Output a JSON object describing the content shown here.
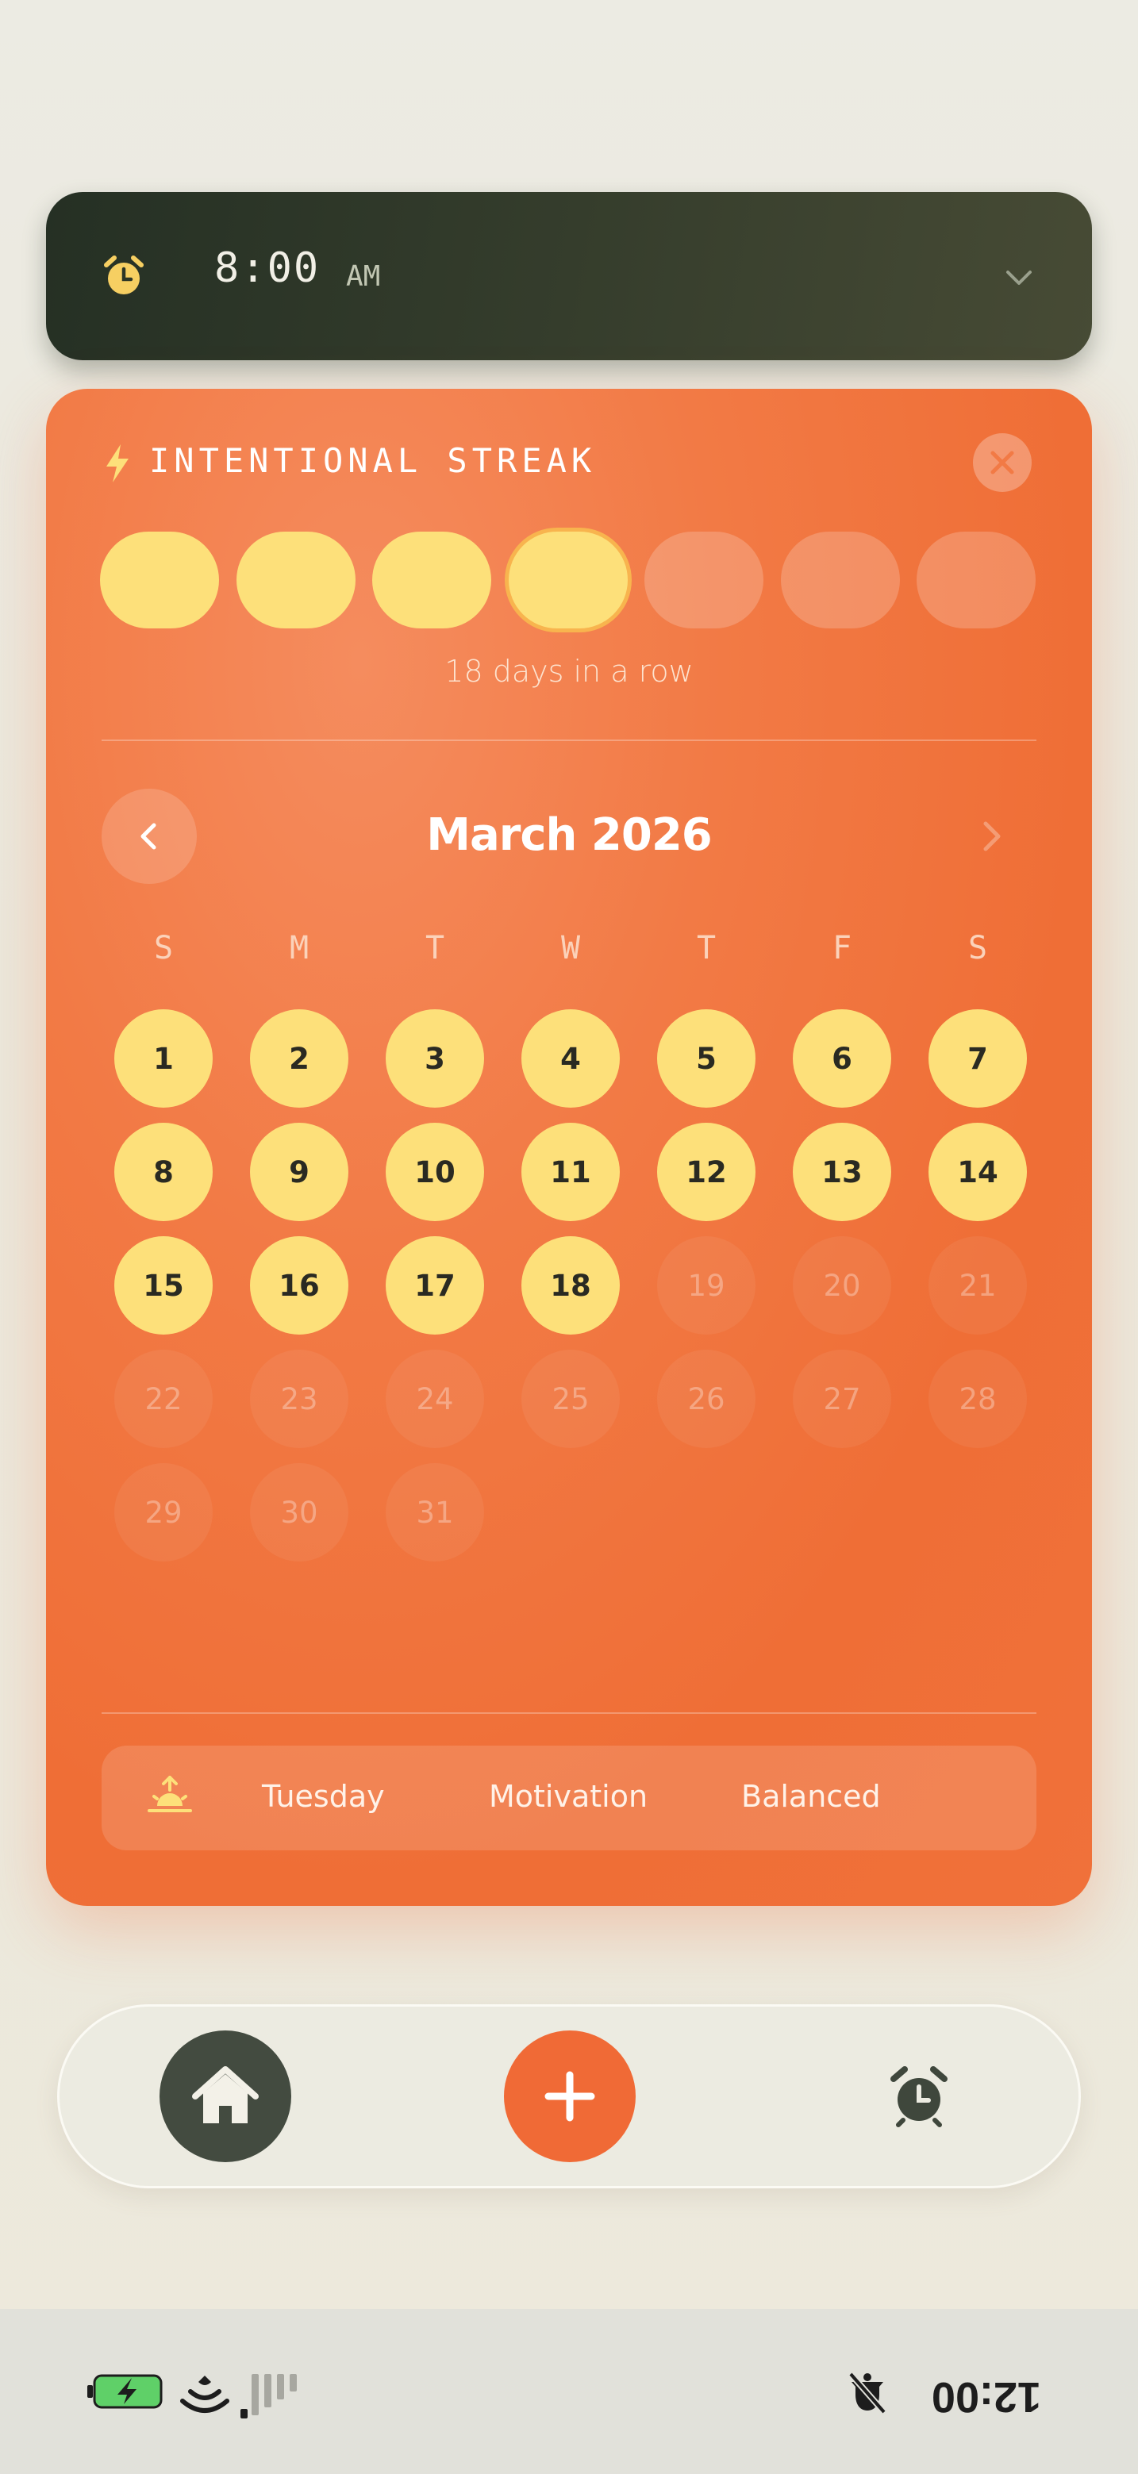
{
  "alarm": {
    "time": "8:00",
    "ampm": "AM",
    "icon": "alarm-clock-icon",
    "expand_icon": "chevron-down-icon"
  },
  "streak_card": {
    "title": "INTENTIONAL STREAK",
    "title_icon": "lightning-bolt-icon",
    "close_icon": "close-x-icon",
    "pills": [
      {
        "state": "filled"
      },
      {
        "state": "filled"
      },
      {
        "state": "filled"
      },
      {
        "state": "current"
      },
      {
        "state": "empty"
      },
      {
        "state": "empty"
      },
      {
        "state": "empty"
      }
    ],
    "streak_text": "18 days in a row",
    "calendar": {
      "month_label": "March 2026",
      "weekdays": [
        "S",
        "M",
        "T",
        "W",
        "T",
        "F",
        "S"
      ],
      "first_weekday_index": 0,
      "days_in_month": 31,
      "completed_through": 18
    },
    "info": {
      "icon": "sunrise-icon",
      "day": "Tuesday",
      "category": "Motivation",
      "mode": "Balanced"
    }
  },
  "bottom_nav": {
    "home_icon": "home-icon",
    "add_icon": "plus-icon",
    "alarm_icon": "alarm-clock-icon"
  },
  "status_bar": {
    "clock": "12:00",
    "rotated_degrees": 180
  },
  "colors": {
    "card_orange": "#f07538",
    "streak_yellow": "#fde07a",
    "alarm_bar_dark": "#2f3829",
    "home_button": "#434b40",
    "add_button": "#f06a36"
  }
}
